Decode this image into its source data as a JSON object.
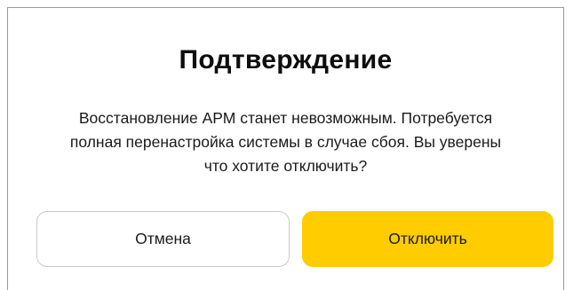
{
  "dialog": {
    "title": "Подтверждение",
    "message": "Восстановление АРМ станет невозможным. Потребуется\nполная перенастройка системы в случае сбоя. Вы уверены\nчто хотите отключить?",
    "cancel_label": "Отмена",
    "confirm_label": "Отключить"
  },
  "colors": {
    "accent": "#ffcc00",
    "text": "#1a1a1a",
    "border": "#c9c9c9"
  }
}
